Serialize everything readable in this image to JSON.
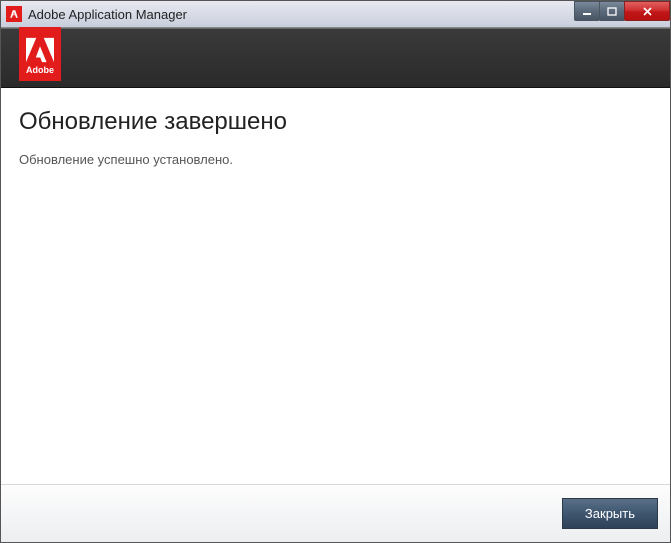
{
  "window": {
    "title": "Adobe Application Manager"
  },
  "badge": {
    "brand": "Adobe"
  },
  "content": {
    "heading": "Обновление завершено",
    "subtext": "Обновление успешно установлено."
  },
  "footer": {
    "close_label": "Закрыть"
  }
}
